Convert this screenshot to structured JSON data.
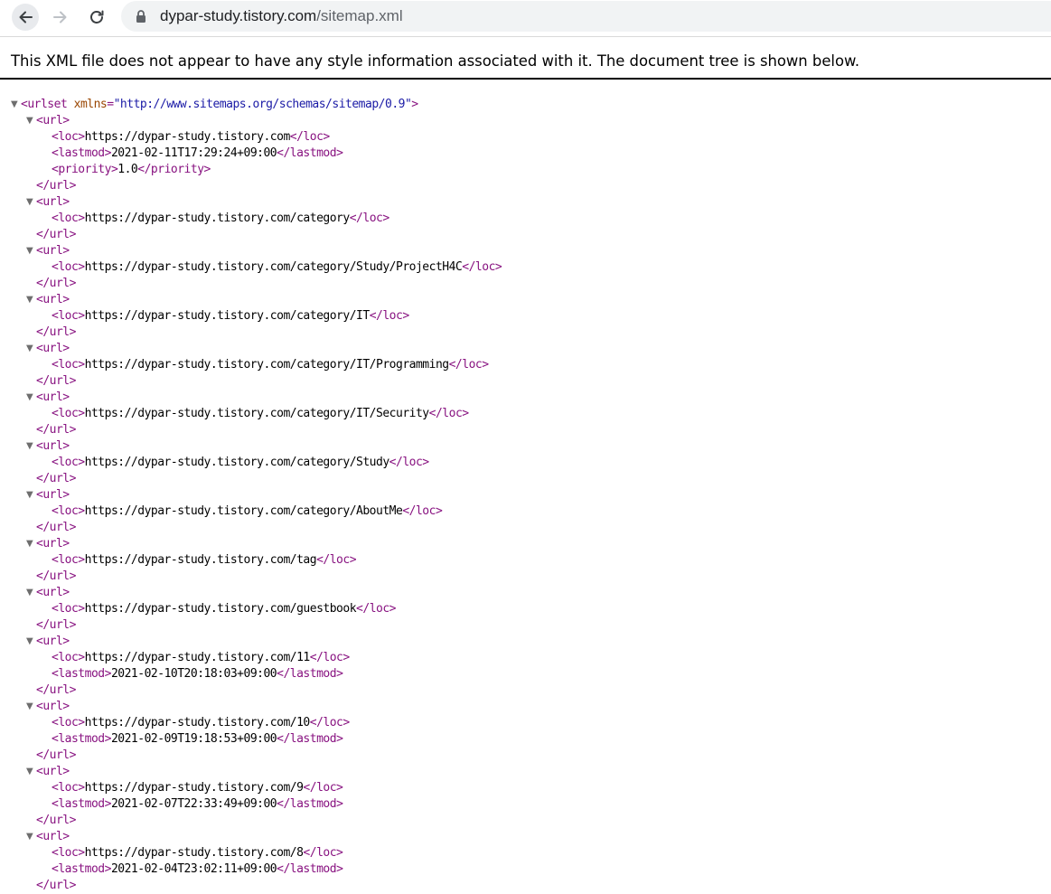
{
  "browser": {
    "url_host": "dypar-study.tistory.com",
    "url_path": "/sitemap.xml"
  },
  "notice": "This XML file does not appear to have any style information associated with it. The document tree is shown below.",
  "xml": {
    "root_open": "<urlset",
    "root_attr": "xmlns",
    "root_attr_value": "\"http://www.sitemaps.org/schemas/sitemap/0.9\"",
    "root_close_bracket": ">",
    "url_open": "<url>",
    "url_close": "</url>",
    "nodes": [
      {
        "loc": "https://dypar-study.tistory.com",
        "lastmod": "2021-02-11T17:29:24+09:00",
        "priority": "1.0"
      },
      {
        "loc": "https://dypar-study.tistory.com/category"
      },
      {
        "loc": "https://dypar-study.tistory.com/category/Study/ProjectH4C"
      },
      {
        "loc": "https://dypar-study.tistory.com/category/IT"
      },
      {
        "loc": "https://dypar-study.tistory.com/category/IT/Programming"
      },
      {
        "loc": "https://dypar-study.tistory.com/category/IT/Security"
      },
      {
        "loc": "https://dypar-study.tistory.com/category/Study"
      },
      {
        "loc": "https://dypar-study.tistory.com/category/AboutMe"
      },
      {
        "loc": "https://dypar-study.tistory.com/tag"
      },
      {
        "loc": "https://dypar-study.tistory.com/guestbook"
      },
      {
        "loc": "https://dypar-study.tistory.com/11",
        "lastmod": "2021-02-10T20:18:03+09:00"
      },
      {
        "loc": "https://dypar-study.tistory.com/10",
        "lastmod": "2021-02-09T19:18:53+09:00"
      },
      {
        "loc": "https://dypar-study.tistory.com/9",
        "lastmod": "2021-02-07T22:33:49+09:00"
      },
      {
        "loc": "https://dypar-study.tistory.com/8",
        "lastmod": "2021-02-04T23:02:11+09:00"
      }
    ]
  }
}
